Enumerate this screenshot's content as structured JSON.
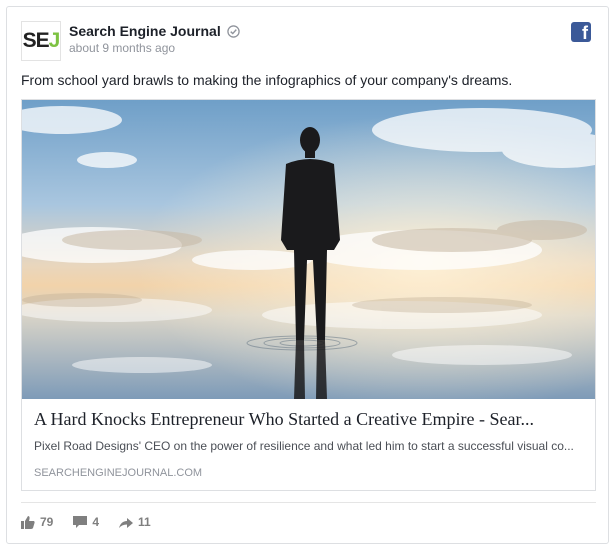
{
  "post": {
    "page_name": "Search Engine Journal",
    "avatar_text": {
      "s": "S",
      "e": "E",
      "j": "J"
    },
    "timestamp": "about 9 months ago",
    "message": "From school yard brawls to making the infographics of your company's dreams.",
    "icons": {
      "verified": "verified-badge-icon",
      "platform": "facebook-icon"
    }
  },
  "link": {
    "title": "A Hard Knocks Entrepreneur Who Started a Creative Empire - Sear...",
    "description": "Pixel Road Designs' CEO on the power of resilience and what led him to start a successful visual co...",
    "domain": "SEARCHENGINEJOURNAL.COM",
    "image": "man in suit standing on reflective water under cloudy sky"
  },
  "stats": {
    "likes": "79",
    "comments": "4",
    "shares": "11"
  },
  "colors": {
    "facebook_blue": "#3b5998",
    "brand_green": "#7dc242",
    "meta_gray": "#90949c"
  }
}
